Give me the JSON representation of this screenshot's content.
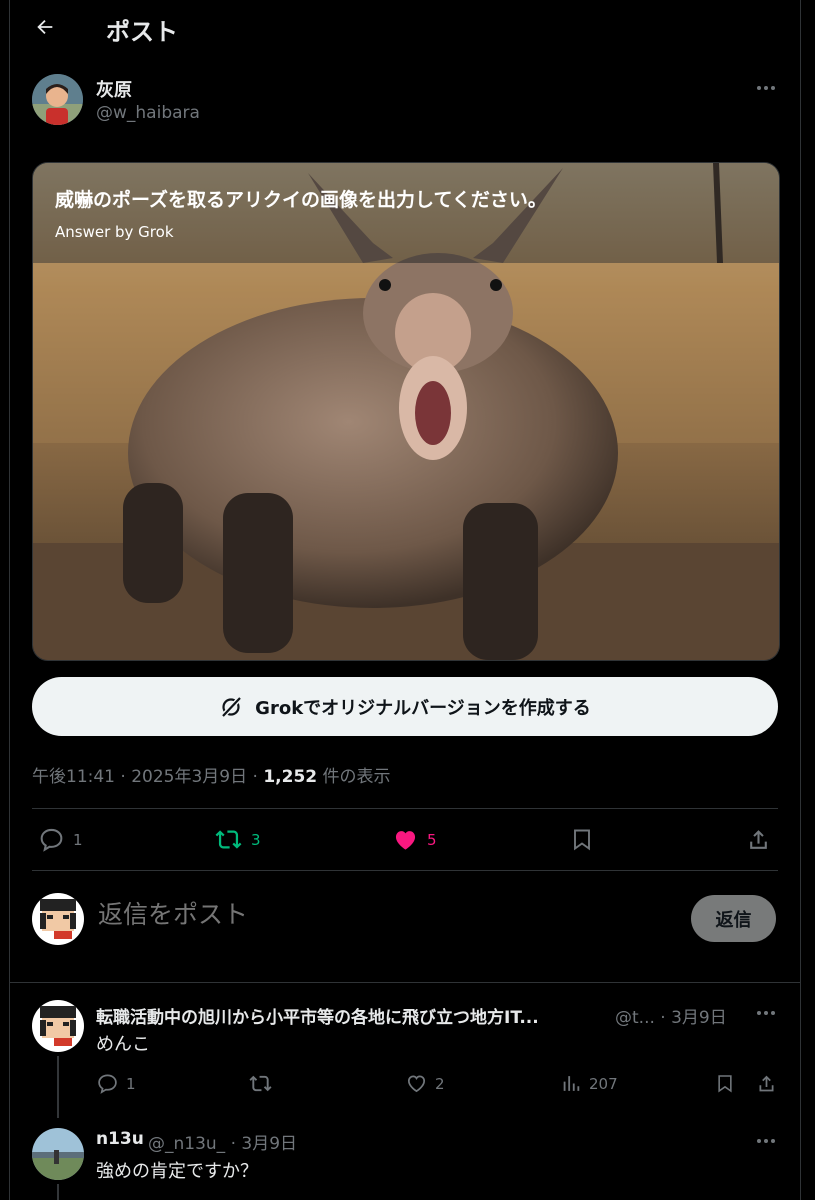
{
  "header": {
    "title": "ポスト"
  },
  "post": {
    "author_name": "灰原",
    "author_handle": "@w_haibara",
    "media_prompt": "威嚇のポーズを取るアリクイの画像を出力してください。",
    "media_subtitle": "Answer by Grok",
    "grok_button_label": "Grokでオリジナルバージョンを作成する",
    "time": "午後11:41",
    "date": "2025年3月9日",
    "views_count": "1,252",
    "views_label": "件の表示",
    "separator": "·",
    "replies": "1",
    "reposts": "3",
    "likes": "5",
    "liked": true
  },
  "composer": {
    "placeholder": "返信をポスト",
    "reply_button": "返信"
  },
  "replies": [
    {
      "name": "転職活動中の旭川から小平市等の各地に飛び立つ地方IT...",
      "handle": "@t...",
      "date": "3月9日",
      "text": "めんこ",
      "replies": "1",
      "reposts": "",
      "likes": "2",
      "views": "207"
    },
    {
      "name": "n13u",
      "handle": "@_n13u_",
      "date": "3月9日",
      "text": "強めの肯定ですか？"
    }
  ],
  "colors": {
    "like": "#f91880",
    "repost": "#00ba7c",
    "muted": "#71767b"
  }
}
